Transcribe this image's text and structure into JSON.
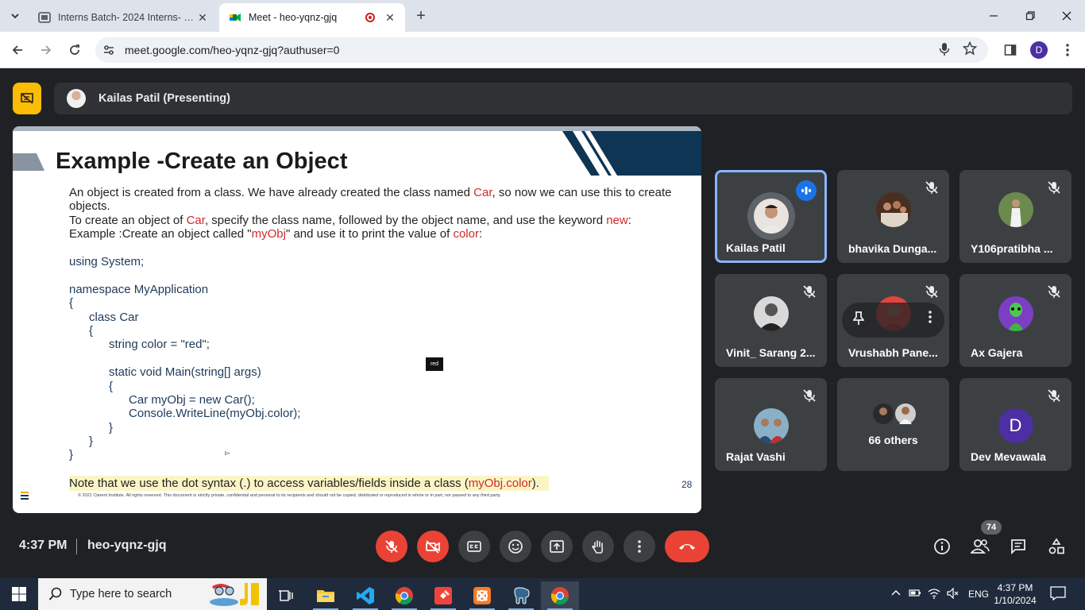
{
  "browser": {
    "tabs": [
      {
        "title": "Interns Batch- 2024 Interns- 20..."
      },
      {
        "title": "Meet - heo-yqnz-gjq"
      }
    ],
    "url": "meet.google.com/heo-yqnz-gjq?authuser=0",
    "profile_initial": "D"
  },
  "meet": {
    "presenter_label": "Kailas Patil (Presenting)",
    "time": "4:37 PM",
    "meeting_code": "heo-yqnz-gjq",
    "participant_count": "74"
  },
  "slide": {
    "title": "Example -Create an Object",
    "line1_a": "An object is created from a class. We have already created the class named ",
    "line1_red": "Car",
    "line1_b": ", so now we can use this to create objects.",
    "line2_a": "To create an object of ",
    "line2_red": "Car",
    "line2_b": ", specify the class name, followed by the object name, and use the keyword ",
    "line2_red2": "new",
    "line2_c": ":",
    "line3_a": "Example :Create an object called \"",
    "line3_red": "myObj",
    "line3_b": "\" and use it to print the value of ",
    "line3_red2": "color",
    "line3_c": ":",
    "code": [
      "using System;",
      "",
      "namespace MyApplication",
      "{",
      "  class Car",
      "  {",
      "    string color = \"red\";",
      "",
      "    static void Main(string[] args)",
      "    {",
      "      Car myObj = new Car();",
      "      Console.WriteLine(myObj.color);",
      "    }",
      "  }",
      "}"
    ],
    "note_a": "Note that we use the dot syntax (",
    "note_dot": ".",
    "note_b": ") to access variables/fields inside a class (",
    "note_red": "myObj.color",
    "note_c": ").",
    "page_number": "28",
    "copyright": "© 2021 Clarent Institute. All rights reserved. This document is strictly private, confidential and personal to its recipients and should not be copied, distributed or reproduced in whole or in part, nor passed to any third party.",
    "tooltip": "red"
  },
  "participants": [
    {
      "name": "Kailas Patil"
    },
    {
      "name": "bhavika Dunga..."
    },
    {
      "name": "Y106pratibha ..."
    },
    {
      "name": "Vinit_ Sarang 2..."
    },
    {
      "name": "Vrushabh Pane..."
    },
    {
      "name": "Ax Gajera"
    },
    {
      "name": "Rajat Vashi"
    },
    {
      "name": "66 others"
    },
    {
      "name": "Dev Mevawala",
      "initial": "D"
    }
  ],
  "taskbar": {
    "search_placeholder": "Type here to search",
    "lang": "ENG",
    "time": "4:37 PM",
    "date": "1/10/2024"
  },
  "colors": {
    "meet_bg": "#202124",
    "accent_red": "#ea4335",
    "active_blue": "#8ab4f8",
    "slide_red_text": "#cf2b2b"
  }
}
